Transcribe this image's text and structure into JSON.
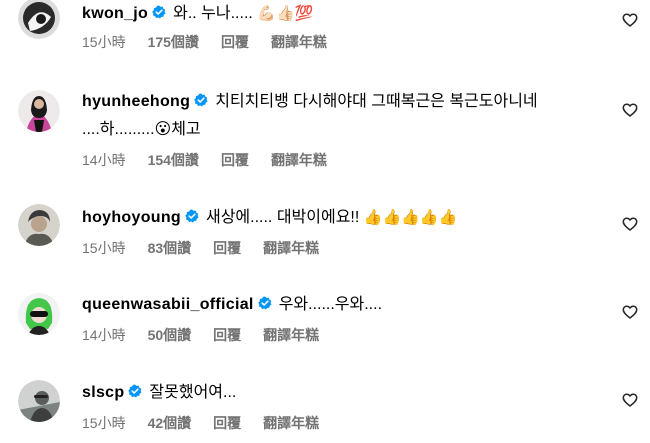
{
  "comments": [
    {
      "username": "kwon_jo",
      "text": "와.. 누나.....",
      "emoji": "💪🏻👍🏻💯",
      "time": "15小時",
      "likes": "175個讚",
      "reply": "回覆",
      "translate": "翻譯年糕"
    },
    {
      "username": "hyunheehong",
      "text": "치티치티뱅 다시해야대 그때복근은 복근도아니네",
      "text_line2": "....하.........😮체고",
      "time": "14小時",
      "likes": "154個讚",
      "reply": "回覆",
      "translate": "翻譯年糕"
    },
    {
      "username": "hoyhoyoung",
      "text": "새상에..... 대박이에요!!",
      "emoji": "👍👍👍👍👍",
      "time": "15小時",
      "likes": "83個讚",
      "reply": "回覆",
      "translate": "翻譯年糕"
    },
    {
      "username": "queenwasabii_official",
      "text": "우와......우와....",
      "time": "14小時",
      "likes": "50個讚",
      "reply": "回覆",
      "translate": "翻譯年糕"
    },
    {
      "username": "slscp",
      "text": "잘못했어여...",
      "time": "15小時",
      "likes": "42個讚",
      "reply": "回覆",
      "translate": "翻譯年糕"
    }
  ],
  "icons": {
    "verified": "verified-badge-icon",
    "like": "heart-outline-icon"
  },
  "colors": {
    "verified_blue": "#0095f6",
    "meta_gray": "#737373"
  }
}
